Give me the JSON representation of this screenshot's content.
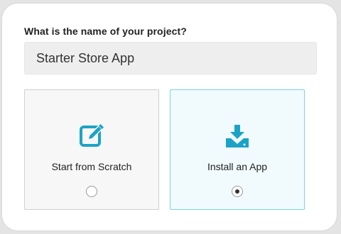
{
  "form": {
    "question": "What is the name of your project?",
    "project_name": "Starter Store App"
  },
  "options": [
    {
      "label": "Start from Scratch",
      "icon": "edit-icon",
      "selected": false
    },
    {
      "label": "Install an App",
      "icon": "download-icon",
      "selected": true
    }
  ],
  "colors": {
    "accent": "#1ba3c6",
    "selected_border": "#7cd2e6",
    "selected_bg": "#f1fbfd"
  }
}
